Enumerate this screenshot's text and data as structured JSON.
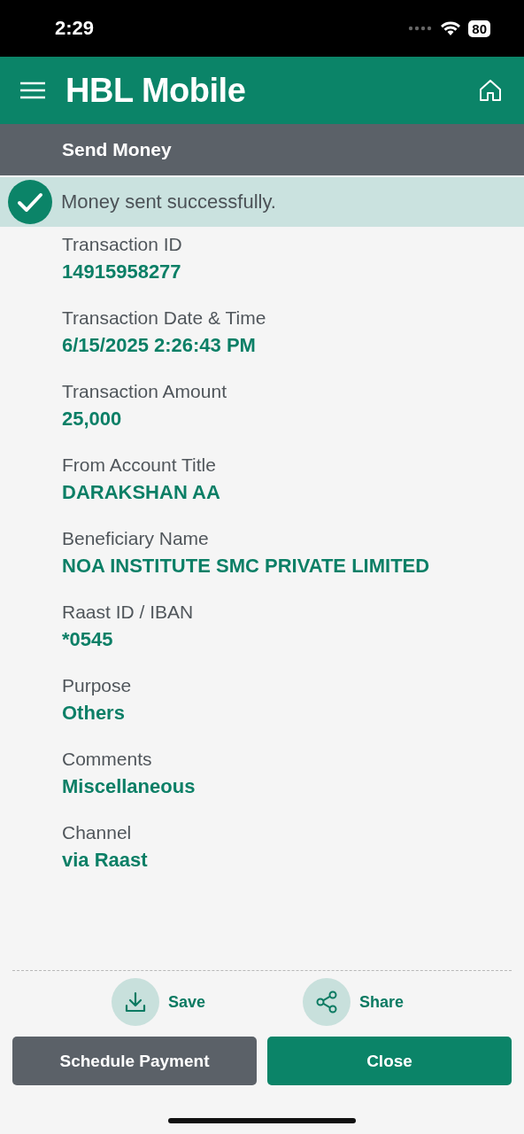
{
  "status_bar": {
    "time": "2:29",
    "battery": "80"
  },
  "header": {
    "logo": "HBL Mobile"
  },
  "page_title": "Send Money",
  "banner": {
    "message": "Money sent successfully."
  },
  "fields": [
    {
      "label": "Transaction ID",
      "value": "14915958277"
    },
    {
      "label": "Transaction Date & Time",
      "value": "6/15/2025 2:26:43 PM"
    },
    {
      "label": "Transaction Amount",
      "value": "25,000"
    },
    {
      "label": "From Account Title",
      "value": "DARAKSHAN AA"
    },
    {
      "label": "Beneficiary Name",
      "value": "NOA INSTITUTE SMC PRIVATE LIMITED"
    },
    {
      "label": "Raast ID / IBAN",
      "value": "*0545"
    },
    {
      "label": "Purpose",
      "value": "Others"
    },
    {
      "label": "Comments",
      "value": "Miscellaneous"
    },
    {
      "label": "Channel",
      "value": "via Raast"
    }
  ],
  "actions": [
    {
      "kind": "save",
      "label": "Save"
    },
    {
      "kind": "share",
      "label": "Share"
    }
  ],
  "buttons": [
    {
      "kind": "secondary",
      "label": "Schedule Payment"
    },
    {
      "kind": "primary",
      "label": "Close"
    }
  ]
}
